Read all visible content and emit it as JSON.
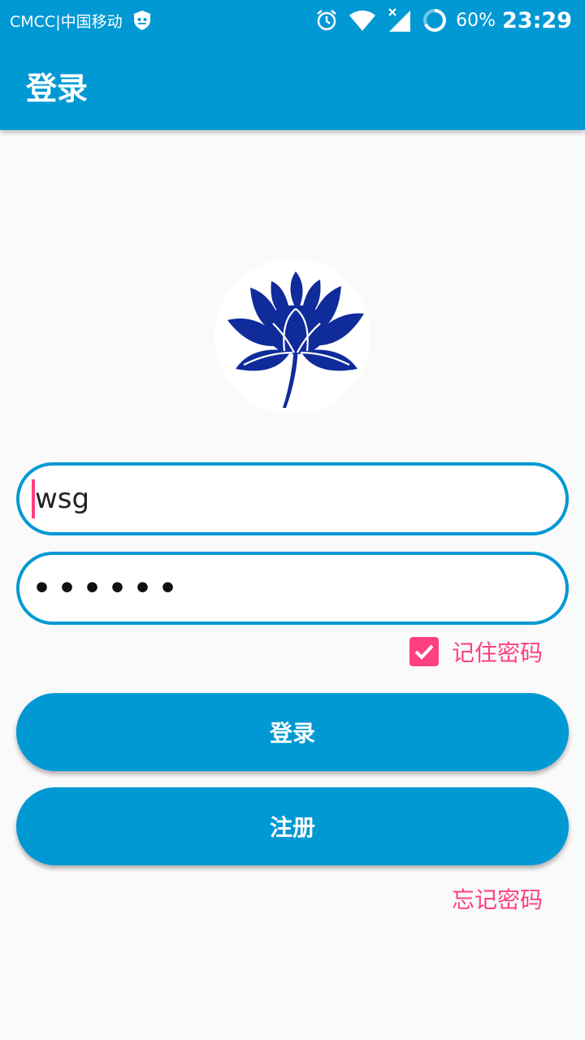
{
  "status_bar": {
    "carrier": "CMCC|中国移动",
    "battery": "60%",
    "time": "23:29",
    "icons": [
      "carrier-badge-icon",
      "alarm-icon",
      "wifi-icon",
      "signal-icon",
      "battery-ring-icon"
    ]
  },
  "app_bar": {
    "title": "登录"
  },
  "logo": {
    "icon": "lotus-logo-icon",
    "color": "#102b9a"
  },
  "form": {
    "username": "wsg",
    "password_mask": "••••••",
    "remember_checked": true,
    "remember_label": "记住密码",
    "login_button": "登录",
    "register_button": "注册",
    "forgot_link": "忘记密码"
  },
  "colors": {
    "primary": "#0099d4",
    "accent": "#ff4081"
  }
}
